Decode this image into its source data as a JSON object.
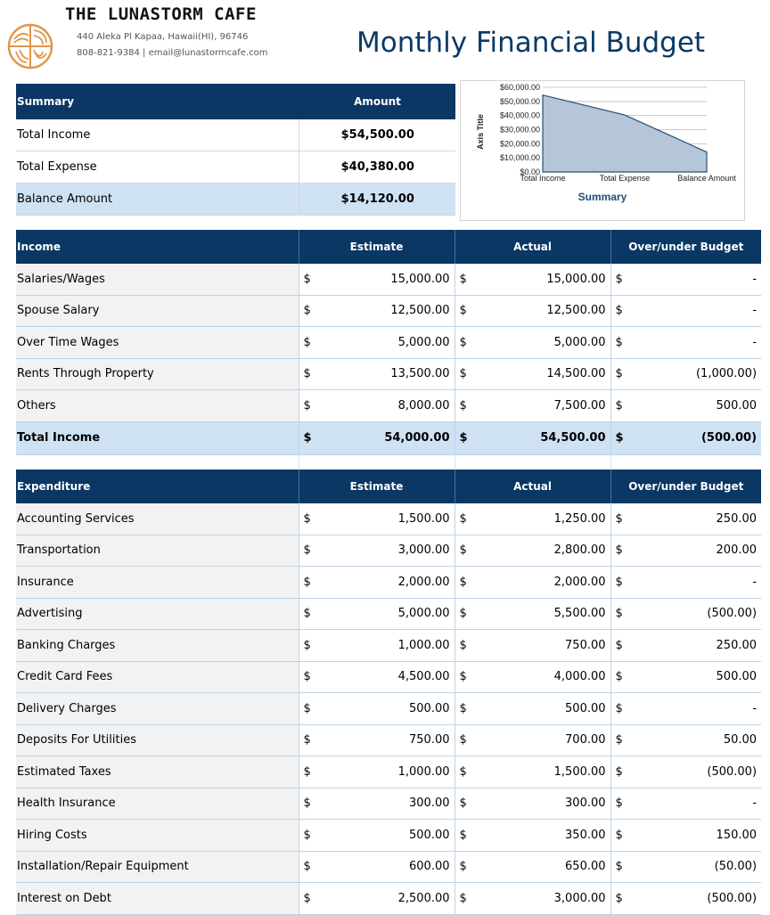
{
  "header": {
    "company": "THE LUNASTORM CAFE",
    "address": "440 Aleka Pl Kapaa, Hawaii(HI), 96746",
    "contact": "808-821-9384 | email@lunastormcafe.com",
    "title": "Monthly Financial Budget",
    "logo": "cafe-logo-icon"
  },
  "colors": {
    "header_bg": "#0a3764",
    "highlight": "#cfe2f3",
    "title": "#0b3a66",
    "chart_fill": "#b4c6d8"
  },
  "summary": {
    "headers": [
      "Summary",
      "Amount"
    ],
    "rows": [
      {
        "label": "Total Income",
        "value": "$54,500.00"
      },
      {
        "label": "Total Expense",
        "value": "$40,380.00"
      },
      {
        "label": "Balance Amount",
        "value": "$14,120.00"
      }
    ]
  },
  "chart_data": {
    "type": "area",
    "title": "Summary",
    "ylabel": "Axis Title",
    "xlabel": "",
    "categories": [
      "Total Income",
      "Total Expense",
      "Balance Amount"
    ],
    "values": [
      54500,
      40380,
      14120
    ],
    "ylim": [
      0,
      60000
    ],
    "yticks": [
      "$0.00",
      "$10,000.00",
      "$20,000.00",
      "$30,000.00",
      "$40,000.00",
      "$50,000.00",
      "$60,000.00"
    ],
    "grid": true
  },
  "income": {
    "headers": [
      "Income",
      "Estimate",
      "Actual",
      "Over/under Budget"
    ],
    "rows": [
      {
        "label": "Salaries/Wages",
        "cur1": "$",
        "estimate": "15,000.00",
        "cur2": "$",
        "actual": "15,000.00",
        "cur3": "$",
        "diff": "-"
      },
      {
        "label": "Spouse Salary",
        "cur1": "$",
        "estimate": "12,500.00",
        "cur2": "$",
        "actual": "12,500.00",
        "cur3": "$",
        "diff": "-"
      },
      {
        "label": "Over Time Wages",
        "cur1": "$",
        "estimate": "5,000.00",
        "cur2": "$",
        "actual": "5,000.00",
        "cur3": "$",
        "diff": "-"
      },
      {
        "label": "Rents Through Property",
        "cur1": "$",
        "estimate": "13,500.00",
        "cur2": "$",
        "actual": "14,500.00",
        "cur3": "$",
        "diff": "(1,000.00)"
      },
      {
        "label": "Others",
        "cur1": "$",
        "estimate": "8,000.00",
        "cur2": "$",
        "actual": "7,500.00",
        "cur3": "$",
        "diff": "500.00"
      }
    ],
    "total": {
      "label": "Total Income",
      "cur1": "$",
      "estimate": "54,000.00",
      "cur2": "$",
      "actual": "54,500.00",
      "cur3": "$",
      "diff": "(500.00)"
    }
  },
  "expenditure": {
    "headers": [
      "Expenditure",
      "Estimate",
      "Actual",
      "Over/under Budget"
    ],
    "rows": [
      {
        "label": "Accounting Services",
        "cur1": "$",
        "estimate": "1,500.00",
        "cur2": "$",
        "actual": "1,250.00",
        "cur3": "$",
        "diff": "250.00"
      },
      {
        "label": "Transportation",
        "cur1": "$",
        "estimate": "3,000.00",
        "cur2": "$",
        "actual": "2,800.00",
        "cur3": "$",
        "diff": "200.00"
      },
      {
        "label": "Insurance",
        "cur1": "$",
        "estimate": "2,000.00",
        "cur2": "$",
        "actual": "2,000.00",
        "cur3": "$",
        "diff": "-"
      },
      {
        "label": "Advertising",
        "cur1": "$",
        "estimate": "5,000.00",
        "cur2": "$",
        "actual": "5,500.00",
        "cur3": "$",
        "diff": "(500.00)"
      },
      {
        "label": "Banking Charges",
        "cur1": "$",
        "estimate": "1,000.00",
        "cur2": "$",
        "actual": "750.00",
        "cur3": "$",
        "diff": "250.00"
      },
      {
        "label": "Credit Card Fees",
        "cur1": "$",
        "estimate": "4,500.00",
        "cur2": "$",
        "actual": "4,000.00",
        "cur3": "$",
        "diff": "500.00"
      },
      {
        "label": "Delivery Charges",
        "cur1": "$",
        "estimate": "500.00",
        "cur2": "$",
        "actual": "500.00",
        "cur3": "$",
        "diff": "-"
      },
      {
        "label": "Deposits For Utilities",
        "cur1": "$",
        "estimate": "750.00",
        "cur2": "$",
        "actual": "700.00",
        "cur3": "$",
        "diff": "50.00"
      },
      {
        "label": "Estimated Taxes",
        "cur1": "$",
        "estimate": "1,000.00",
        "cur2": "$",
        "actual": "1,500.00",
        "cur3": "$",
        "diff": "(500.00)"
      },
      {
        "label": "Health Insurance",
        "cur1": "$",
        "estimate": "300.00",
        "cur2": "$",
        "actual": "300.00",
        "cur3": "$",
        "diff": "-"
      },
      {
        "label": "Hiring Costs",
        "cur1": "$",
        "estimate": "500.00",
        "cur2": "$",
        "actual": "350.00",
        "cur3": "$",
        "diff": "150.00"
      },
      {
        "label": "Installation/Repair Equipment",
        "cur1": "$",
        "estimate": "600.00",
        "cur2": "$",
        "actual": "650.00",
        "cur3": "$",
        "diff": "(50.00)"
      },
      {
        "label": "Interest on Debt",
        "cur1": "$",
        "estimate": "2,500.00",
        "cur2": "$",
        "actual": "3,000.00",
        "cur3": "$",
        "diff": "(500.00)"
      }
    ]
  }
}
